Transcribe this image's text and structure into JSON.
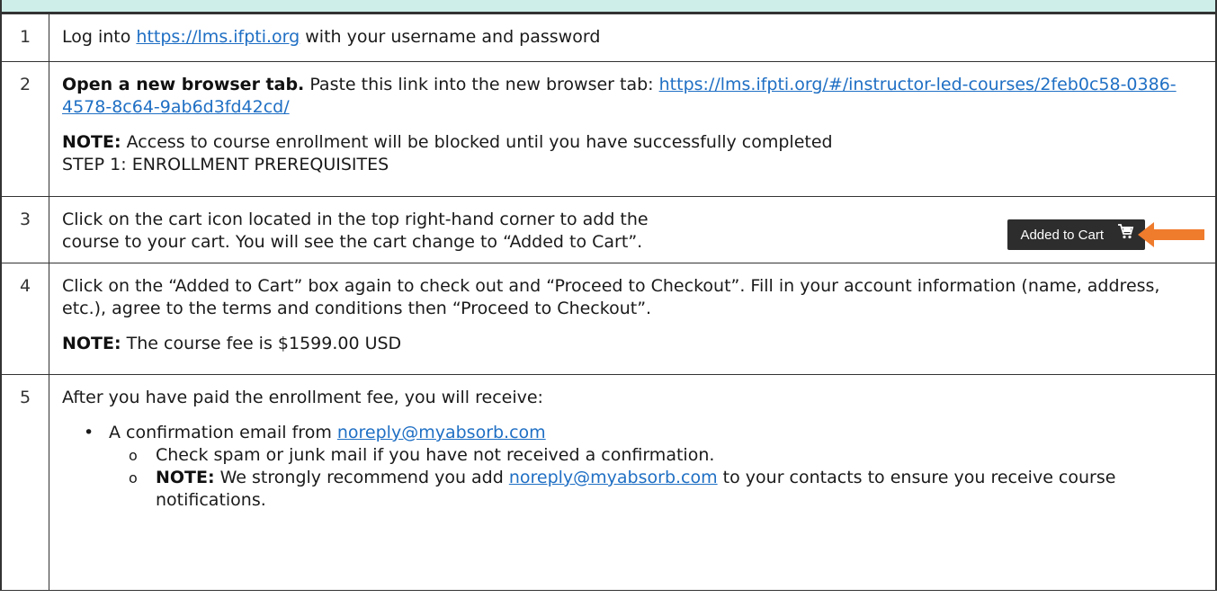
{
  "rows": [
    {
      "num": "1",
      "pre": "Log into ",
      "link": "https://lms.ifpti.org",
      "post": " with your username and password"
    },
    {
      "num": "2",
      "bold": "Open a new browser tab.",
      "text": " Paste this link into the new browser tab: ",
      "link": "https://lms.ifpti.org/#/instructor-led-courses/2feb0c58-0386-4578-8c64-9ab6d3fd42cd/",
      "note_label": "NOTE:",
      "note_text": " Access to course enrollment will be blocked until you have successfully completed",
      "note_text2": "STEP 1: ENROLLMENT PREREQUISITES"
    },
    {
      "num": "3",
      "text_line1": "Click on the cart icon located in the top right-hand corner to add the",
      "text_line2": "course to your cart. You will see the cart change to “Added to Cart”.",
      "cart_label": "Added to Cart",
      "cart_icon": "cart-icon",
      "arrow_color": "#ef7b2d"
    },
    {
      "num": "4",
      "text": "Click on the “Added to Cart” box again to check out and “Proceed to Checkout”. Fill in your account information (name, address, etc.), agree to the terms and conditions then “Proceed to Checkout”.",
      "note_label": "NOTE:",
      "note_text": " The course fee is $1599.00 USD"
    },
    {
      "num": "5",
      "intro": "After you have paid the enrollment fee, you will receive:",
      "bullet_pre": "A confirmation email from ",
      "bullet_link": "noreply@myabsorb.com",
      "sub1": "Check spam or junk mail if you have not received a confirmation.",
      "sub2_label": "NOTE:",
      "sub2_pre": " We strongly recommend you add ",
      "sub2_link": "noreply@myabsorb.com",
      "sub2_post": " to your contacts to ensure you receive course notifications."
    }
  ],
  "colors": {
    "header_band": "#cdeee9",
    "link": "#1f6fc4",
    "cart_button": "#2d2d2d",
    "arrow": "#ef7b2d"
  }
}
